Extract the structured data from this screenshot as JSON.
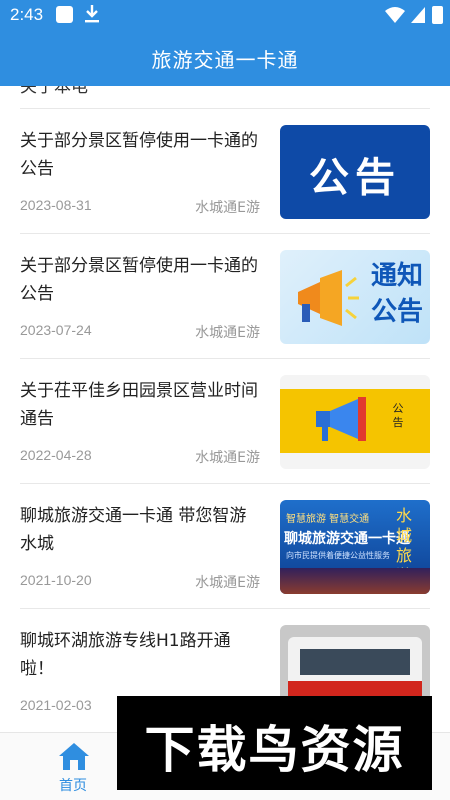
{
  "status_bar": {
    "time": "2:43",
    "icons": [
      "square-notification-icon",
      "download-icon",
      "wifi-icon",
      "signal-icon",
      "battery-icon"
    ]
  },
  "app_bar": {
    "title": "旅游交通一卡通"
  },
  "list": {
    "partial_text": "关于本电",
    "items": [
      {
        "title": "关于部分景区暂停使用一卡通的公告",
        "date": "2023-08-31",
        "source": "水城通E游",
        "thumb_text": "公告"
      },
      {
        "title": "关于部分景区暂停使用一卡通的公告",
        "date": "2023-07-24",
        "source": "水城通E游",
        "thumb_text": "通知公告"
      },
      {
        "title": "关于茌平佳乡田园景区营业时间通告",
        "date": "2022-04-28",
        "source": "水城通E游",
        "thumb_text": "公告"
      },
      {
        "title": "聊城旅游交通一卡通 带您智游水城",
        "date": "2021-10-20",
        "source": "水城通E游",
        "thumb_line1": "智慧旅游   智慧交通",
        "thumb_line2": "聊城旅游交通一卡通",
        "thumb_line3": "向市民提供着便捷公益性服务",
        "thumb_side": "水城旅游"
      },
      {
        "title": "聊城环湖旅游专线H1路开通啦！",
        "date": "2021-02-03",
        "source": ""
      }
    ]
  },
  "tab_bar": {
    "home_label": "首页"
  },
  "watermark": {
    "text": "下载鸟资源"
  },
  "colors": {
    "primary": "#2f8ee0",
    "title_text": "#222222",
    "meta_text": "#999999"
  }
}
